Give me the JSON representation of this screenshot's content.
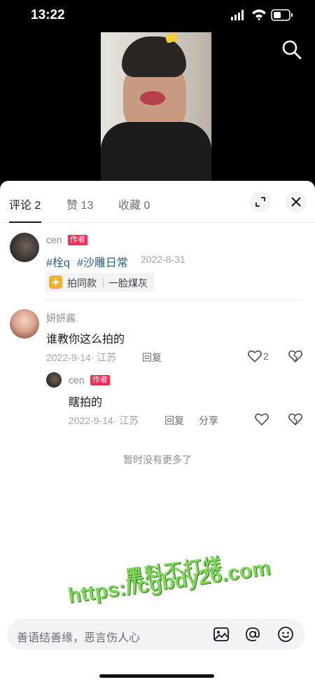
{
  "status_bar": {
    "time": "13:22"
  },
  "tabs": [
    {
      "label": "评论 2"
    },
    {
      "label": "赞 13"
    },
    {
      "label": "收藏 0"
    }
  ],
  "post": {
    "username": "cen",
    "badge": "作者",
    "hashtags": [
      "#栓q",
      "#沙雕日常"
    ],
    "date": "2022-8-31",
    "chip": {
      "label": "拍同款",
      "name": "一脸煤灰"
    }
  },
  "comments": [
    {
      "username": "妍妍酱.",
      "text": "谁教你这么拍的",
      "meta": "2022-9-14· 江苏",
      "reply_label": "回复",
      "likes": "2",
      "replies": [
        {
          "username": "cen",
          "badge": "作者",
          "text": "瞎拍的",
          "meta": "2022-9-14· 江苏",
          "reply_label": "回复",
          "share_label": "分享"
        }
      ]
    }
  ],
  "no_more": "暂时没有更多了",
  "watermark": {
    "line1": "黑料不打烊",
    "line2": "https://cgbdy26.com"
  },
  "input": {
    "placeholder": "善语结善缘，恶言伤人心"
  },
  "colors": {
    "accent": "#fe2c55",
    "hashtag": "#2e5c8a",
    "watermark": "#7ed957"
  }
}
